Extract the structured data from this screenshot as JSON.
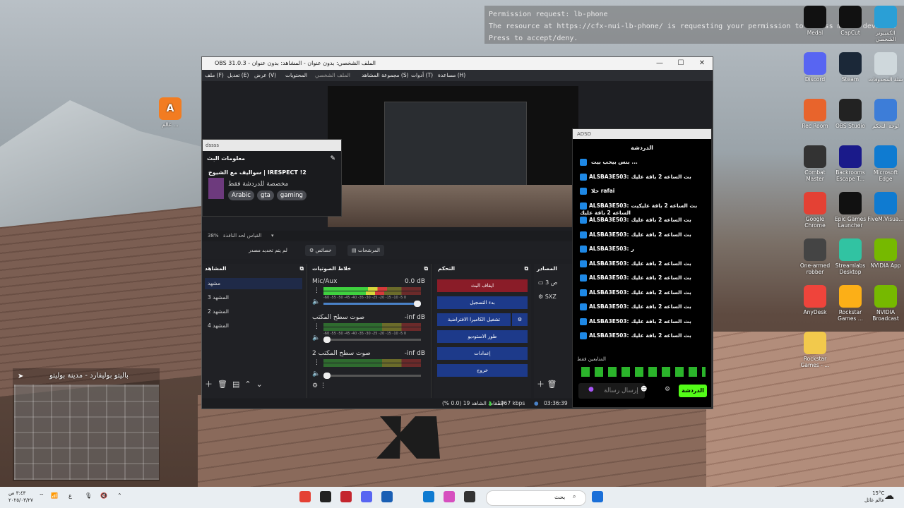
{
  "permission": {
    "line1": "Permission request: lb-phone",
    "line2": "The resource at https://cfx-nui-lb-phone/ is requesting your permission to access media devices.",
    "line3": "Press      to accept/deny."
  },
  "desktop_icons": [
    {
      "label": "Medal",
      "icon": "medal-icon",
      "color": "#111"
    },
    {
      "label": "CapCut",
      "icon": "capcut-icon",
      "color": "#111"
    },
    {
      "label": "الكمبيوتر الشخصي",
      "icon": "pc-icon",
      "color": "#2a9fd6"
    },
    {
      "label": "Discord",
      "icon": "discord-icon",
      "color": "#5865f2"
    },
    {
      "label": "Steam",
      "icon": "steam-icon",
      "color": "#1b2838"
    },
    {
      "label": "سلة المحذوفات",
      "icon": "recycle-bin-icon",
      "color": "#cfd8dc"
    },
    {
      "label": "Rec Room",
      "icon": "recroom-icon",
      "color": "#e8642c"
    },
    {
      "label": "OBS Studio",
      "icon": "obs-icon",
      "color": "#222"
    },
    {
      "label": "لوحة التحكم",
      "icon": "control-panel-icon",
      "color": "#3d7dd8"
    },
    {
      "label": "Combat Master",
      "icon": "combat-master-icon",
      "color": "#333"
    },
    {
      "label": "Backrooms Escape T...",
      "icon": "backrooms-icon",
      "color": "#1a1a8a"
    },
    {
      "label": "Microsoft Edge",
      "icon": "edge-icon",
      "color": "#0f7bd1"
    },
    {
      "label": "Google Chrome",
      "icon": "chrome-icon",
      "color": "#e44134"
    },
    {
      "label": "Epic Games Launcher",
      "icon": "epic-icon",
      "color": "#111"
    },
    {
      "label": "FiveM.Visua...",
      "icon": "edge-icon",
      "color": "#0f7bd1"
    },
    {
      "label": "One-armed robber",
      "icon": "oar-icon",
      "color": "#444"
    },
    {
      "label": "Streamlabs Desktop",
      "icon": "streamlabs-icon",
      "color": "#31c3a2"
    },
    {
      "label": "NVIDIA App",
      "icon": "nvidia-icon",
      "color": "#76b900"
    },
    {
      "label": "AnyDesk",
      "icon": "anydesk-icon",
      "color": "#ef443b"
    },
    {
      "label": "Rockstar Games ...",
      "icon": "rockstar-icon",
      "color": "#fcaf17"
    },
    {
      "label": "NVIDIA Broadcast",
      "icon": "nvidia-icon",
      "color": "#76b900"
    },
    {
      "label": "Rockstar Games - ...",
      "icon": "folder-icon",
      "color": "#f2c94c"
    }
  ],
  "left_desktop_icon": {
    "label": "عالم ...",
    "icon": "app-icon"
  },
  "obs": {
    "title": "OBS 31.0.3 - الملف الشخصي: بدون عنوان - المشاهد: بدون عنوان",
    "menu": [
      "ملف (F)",
      "تعديل (E)",
      "عرض (V)",
      "المحتويات",
      "الملف الشخصي",
      "مجموعة المشاهد (S)",
      "أدوات (T)",
      "مساعدة (H)"
    ],
    "info_dock": {
      "header": "dssss",
      "title": "معلومات البث",
      "stream_title": "سواليف مع الشيوخ | IRESPECT !2",
      "category": "مخصصة للدردشة فقط",
      "tags": [
        "Arabic",
        "gta",
        "gaming"
      ]
    },
    "zoom": "38%",
    "zoom_label": "القياس لحد النافذة",
    "no_source": "لم يتم تحديد مصدر",
    "properties": "خصائص",
    "filters": "المرشحات",
    "scenes": {
      "title": "المشاهد",
      "items": [
        "مشهد",
        "المشهد 3",
        "المشهد 2",
        "المشهد 4"
      ]
    },
    "sources": {
      "title": "المصادر",
      "items": [
        "ص 3",
        "SXZ"
      ]
    },
    "mixer": {
      "title": "خلاط الصوتيات",
      "channels": [
        {
          "name": "Mic/Aux",
          "db": "0.0 dB",
          "level": 0.65,
          "volume": 1.0
        },
        {
          "name": "صوت سطح المكتب",
          "db": "-inf dB",
          "level": 0.0,
          "volume": 0.04
        },
        {
          "name": "صوت سطح المكتب 2",
          "db": "-inf dB",
          "level": 0.0,
          "volume": 0.04
        }
      ],
      "ticks": "-60 -55 -50 -45 -40 -35 -30 -25 -20 -15 -10 -5 0"
    },
    "controls": {
      "title": "التحكم",
      "buttons": [
        "ايقاف البث",
        "بدء التسجيل",
        "تشغيل الكاميرا الافتراضية",
        "طور الاستوديو",
        "إعدادات",
        "خروج"
      ]
    },
    "status": {
      "dropped": "إسقاط الشاهد 19 (0.0 %)",
      "kbps": "1967 kbps",
      "time": "03:36:39"
    }
  },
  "chat": {
    "header": "ADSD",
    "title": "الدردشة",
    "messages": [
      {
        "user": "",
        "text": "بنس بيحب بيت ..."
      },
      {
        "user": "ALSBA3E503:",
        "text": "بث الساعه 2 باقة عليك"
      },
      {
        "user": "",
        "text": "حلا rafai"
      },
      {
        "user": "ALSBA3E503:",
        "text": "بث الساعه 2 باقة عليكيت الساعه 2 باقة عليك"
      },
      {
        "user": "ALSBA3E503:",
        "text": "بث الساعه 2 باقة عليك"
      },
      {
        "user": "ALSBA3E503:",
        "text": "بث الساعه 2 باقة عليك"
      },
      {
        "user": "ALSBA3E503:",
        "text": "ر"
      },
      {
        "user": "ALSBA3E503:",
        "text": "بث الساعه 2 باقة عليك"
      },
      {
        "user": "ALSBA3E503:",
        "text": "بث الساعه 2 باقة عليك"
      },
      {
        "user": "ALSBA3E503:",
        "text": "بث الساعه 2 باقة عليك"
      },
      {
        "user": "ALSBA3E503:",
        "text": "بث الساعه 2 باقة عليك"
      },
      {
        "user": "ALSBA3E503:",
        "text": "بث الساعه 2 باقة عليك"
      },
      {
        "user": "ALSBA3E503:",
        "text": "بث الساعه 2 باقة عليك"
      }
    ],
    "followers_only": "المتابعين فقط",
    "input_placeholder": "إرسال رسالة",
    "send": "الدردشة"
  },
  "minimap": {
    "location": "باليتو بوليفارد - مدينة بوليتو"
  },
  "taskbar": {
    "search": "بحث",
    "weather": "15°C",
    "weather_sub": "عالم غائل",
    "clock": "٣:٤٣ ص",
    "date": "٢٠٢٥/٠٣/٢٧"
  }
}
